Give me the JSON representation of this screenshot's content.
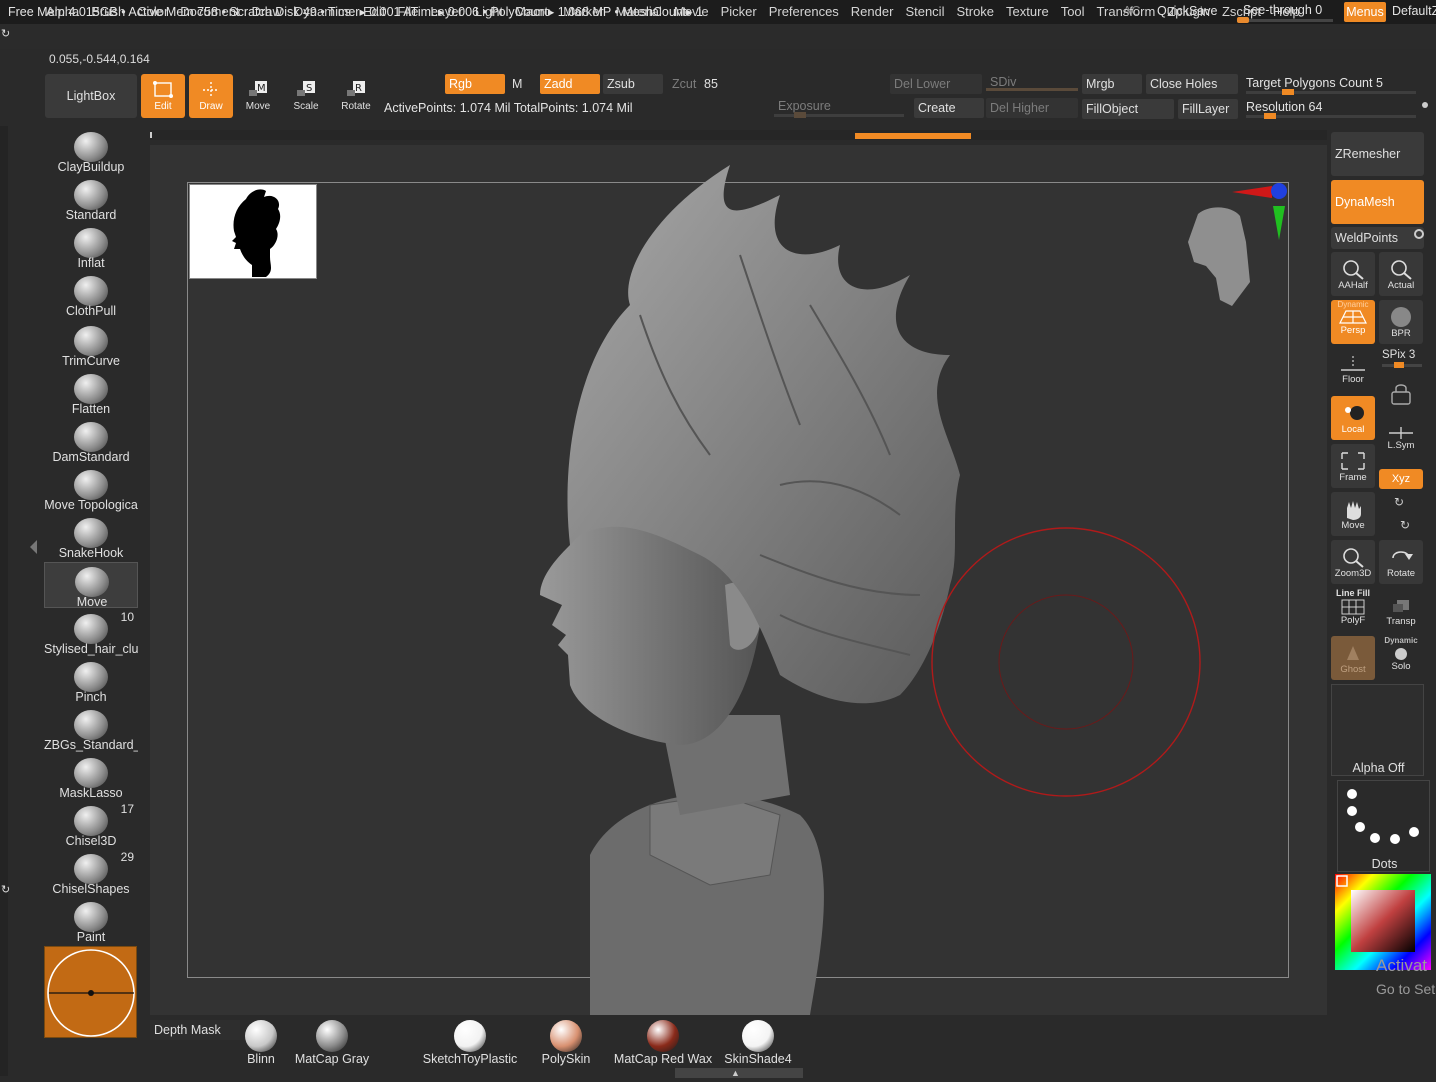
{
  "status": {
    "text": "Free Mem 4.015GB • Active Mem 758 • Scratch Disk 49 •  Timer▸ 0.001 ATime▸ 0.006 • PolyCount▸ 1.068 MP  • MeshCount▸ 1",
    "ac": "AC",
    "quicksave": "QuickSave",
    "seethrough": "See-through  0",
    "seethrough_value": 0,
    "menus": "Menus",
    "default": "DefaultZ"
  },
  "menubar": [
    "Alpha",
    "Brush",
    "Color",
    "Document",
    "Draw",
    "Dynamics",
    "Edit",
    "File",
    "Layer",
    "Light",
    "Macro",
    "Marker",
    "Material",
    "Movie",
    "Picker",
    "Preferences",
    "Render",
    "Stencil",
    "Stroke",
    "Texture",
    "Tool",
    "Transform",
    "Zplugin",
    "Zscript",
    "Help"
  ],
  "coords": "0.055,-0.544,0.164",
  "toolbar": {
    "lightbox": "LightBox",
    "edit": "Edit",
    "draw": "Draw",
    "move": "Move",
    "scale": "Scale",
    "rotate": "Rotate",
    "rgb": "Rgb",
    "m": "M",
    "zadd": "Zadd",
    "zsub": "Zsub",
    "zcut": "Zcut",
    "zcut_value": "85",
    "active_points": "ActivePoints: 1.074 Mil TotalPoints: 1.074 Mil",
    "del_lower": "Del Lower",
    "del_higher": "Del Higher",
    "sdiv": "SDiv",
    "exposure": "Exposure",
    "create": "Create",
    "mrgb": "Mrgb",
    "fill_object": "FillObject",
    "close_holes": "Close Holes",
    "fill_layer": "FillLayer",
    "target_polygons": "Target Polygons Count 5",
    "resolution": "Resolution 64"
  },
  "brushes": [
    {
      "label": "ClayBuildup",
      "count": ""
    },
    {
      "label": "Standard",
      "count": ""
    },
    {
      "label": "Inflat",
      "count": ""
    },
    {
      "label": "ClothPull",
      "count": ""
    },
    {
      "label": "TrimCurve",
      "count": ""
    },
    {
      "label": "Flatten",
      "count": ""
    },
    {
      "label": "DamStandard",
      "count": ""
    },
    {
      "label": "Move Topologica",
      "count": ""
    },
    {
      "label": "SnakeHook",
      "count": ""
    },
    {
      "label": "Move",
      "count": ""
    },
    {
      "label": "Stylised_hair_clu",
      "count": "10"
    },
    {
      "label": "Pinch",
      "count": ""
    },
    {
      "label": "ZBGs_Standard_I",
      "count": ""
    },
    {
      "label": "MaskLasso",
      "count": ""
    },
    {
      "label": "Chisel3D",
      "count": "17"
    },
    {
      "label": "ChiselShapes",
      "count": "29"
    },
    {
      "label": "Paint",
      "count": ""
    }
  ],
  "right_panel": {
    "zremesher": "ZRemesher",
    "dynamesh": "DynaMesh",
    "weldpoints": "WeldPoints",
    "aahalf": "AAHalf",
    "actual": "Actual",
    "dynamic": "Dynamic",
    "persp": "Persp",
    "bpr": "BPR",
    "spix": "SPix 3",
    "floor": "Floor",
    "local": "Local",
    "lsym": "L.Sym",
    "frame": "Frame",
    "xyz": "Xyz",
    "move": "Move",
    "zoom3d": "Zoom3D",
    "rotate": "Rotate",
    "line_fill": "Line Fill",
    "polyf": "PolyF",
    "transp": "Transp",
    "ghost": "Ghost",
    "dynamic2": "Dynamic",
    "solo": "Solo",
    "alpha_off": "Alpha Off",
    "dots": "Dots"
  },
  "materials": [
    {
      "label": "Blinn",
      "color": "#c8c8c8"
    },
    {
      "label": "MatCap Gray",
      "color": "#8c8c8c"
    },
    {
      "label": "SketchToyPlastic",
      "color": "#f2f2f2"
    },
    {
      "label": "PolySkin",
      "color": "#d89070"
    },
    {
      "label": "MatCap Red Wax",
      "color": "#8a2a1a"
    },
    {
      "label": "SkinShade4",
      "color": "#f4f4f4"
    }
  ],
  "depth_mask": "Depth Mask",
  "watermark": {
    "line1": "Activat",
    "line2": "Go to Set"
  },
  "colors": {
    "accent": "#f08a24",
    "panel": "#2a2a2a",
    "canvas": "#333333"
  }
}
